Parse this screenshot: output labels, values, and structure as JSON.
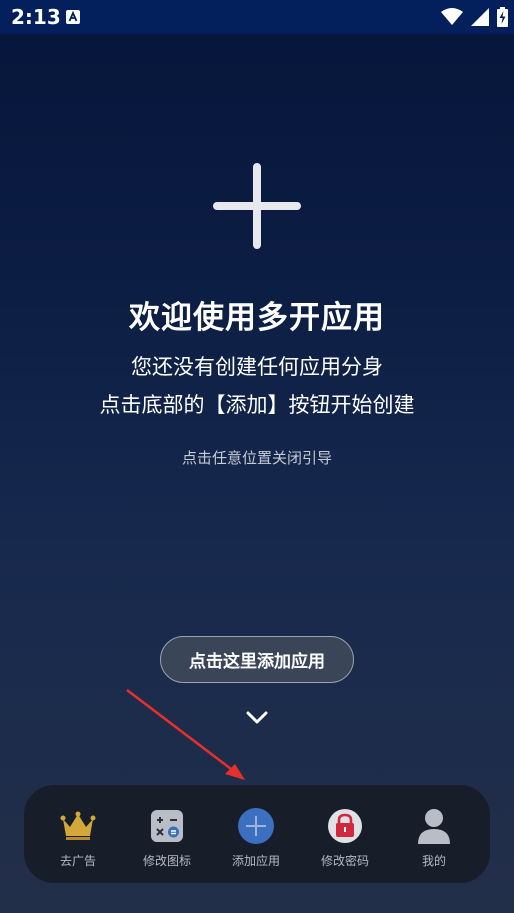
{
  "status_bar": {
    "time": "2:13"
  },
  "welcome": {
    "title": "欢迎使用多开应用",
    "line1": "您还没有创建任何应用分身",
    "line2": "点击底部的【添加】按钮开始创建",
    "dismiss_hint": "点击任意位置关闭引导"
  },
  "tooltip": {
    "label": "点击这里添加应用"
  },
  "nav": [
    {
      "label": "去广告",
      "icon": "crown-icon"
    },
    {
      "label": "修改图标",
      "icon": "calculator-icon"
    },
    {
      "label": "添加应用",
      "icon": "add-circle-icon"
    },
    {
      "label": "修改密码",
      "icon": "lock-icon"
    },
    {
      "label": "我的",
      "icon": "user-icon"
    }
  ],
  "colors": {
    "status_bar": "#03205d",
    "background_top": "#06153a",
    "background_bottom": "#232f49",
    "nav_background": "#171d29",
    "crown": "#d4a73b",
    "add_button": "#3b6fc0",
    "lock": "#d1283e",
    "arrow": "#e8302a"
  }
}
